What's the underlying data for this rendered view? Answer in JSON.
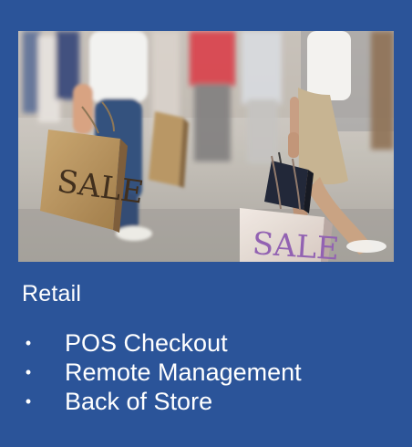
{
  "photo": {
    "description_visible_text": "SALE",
    "bag_label_1": "SALE",
    "bag_label_2": "SALE"
  },
  "card": {
    "title": "Retail",
    "items": [
      {
        "bullet": "•",
        "label": "POS Checkout"
      },
      {
        "bullet": "•",
        "label": "Remote Management"
      },
      {
        "bullet": "•",
        "label": "Back of Store"
      }
    ]
  },
  "colors": {
    "background": "#2b5499",
    "text": "#ffffff"
  }
}
